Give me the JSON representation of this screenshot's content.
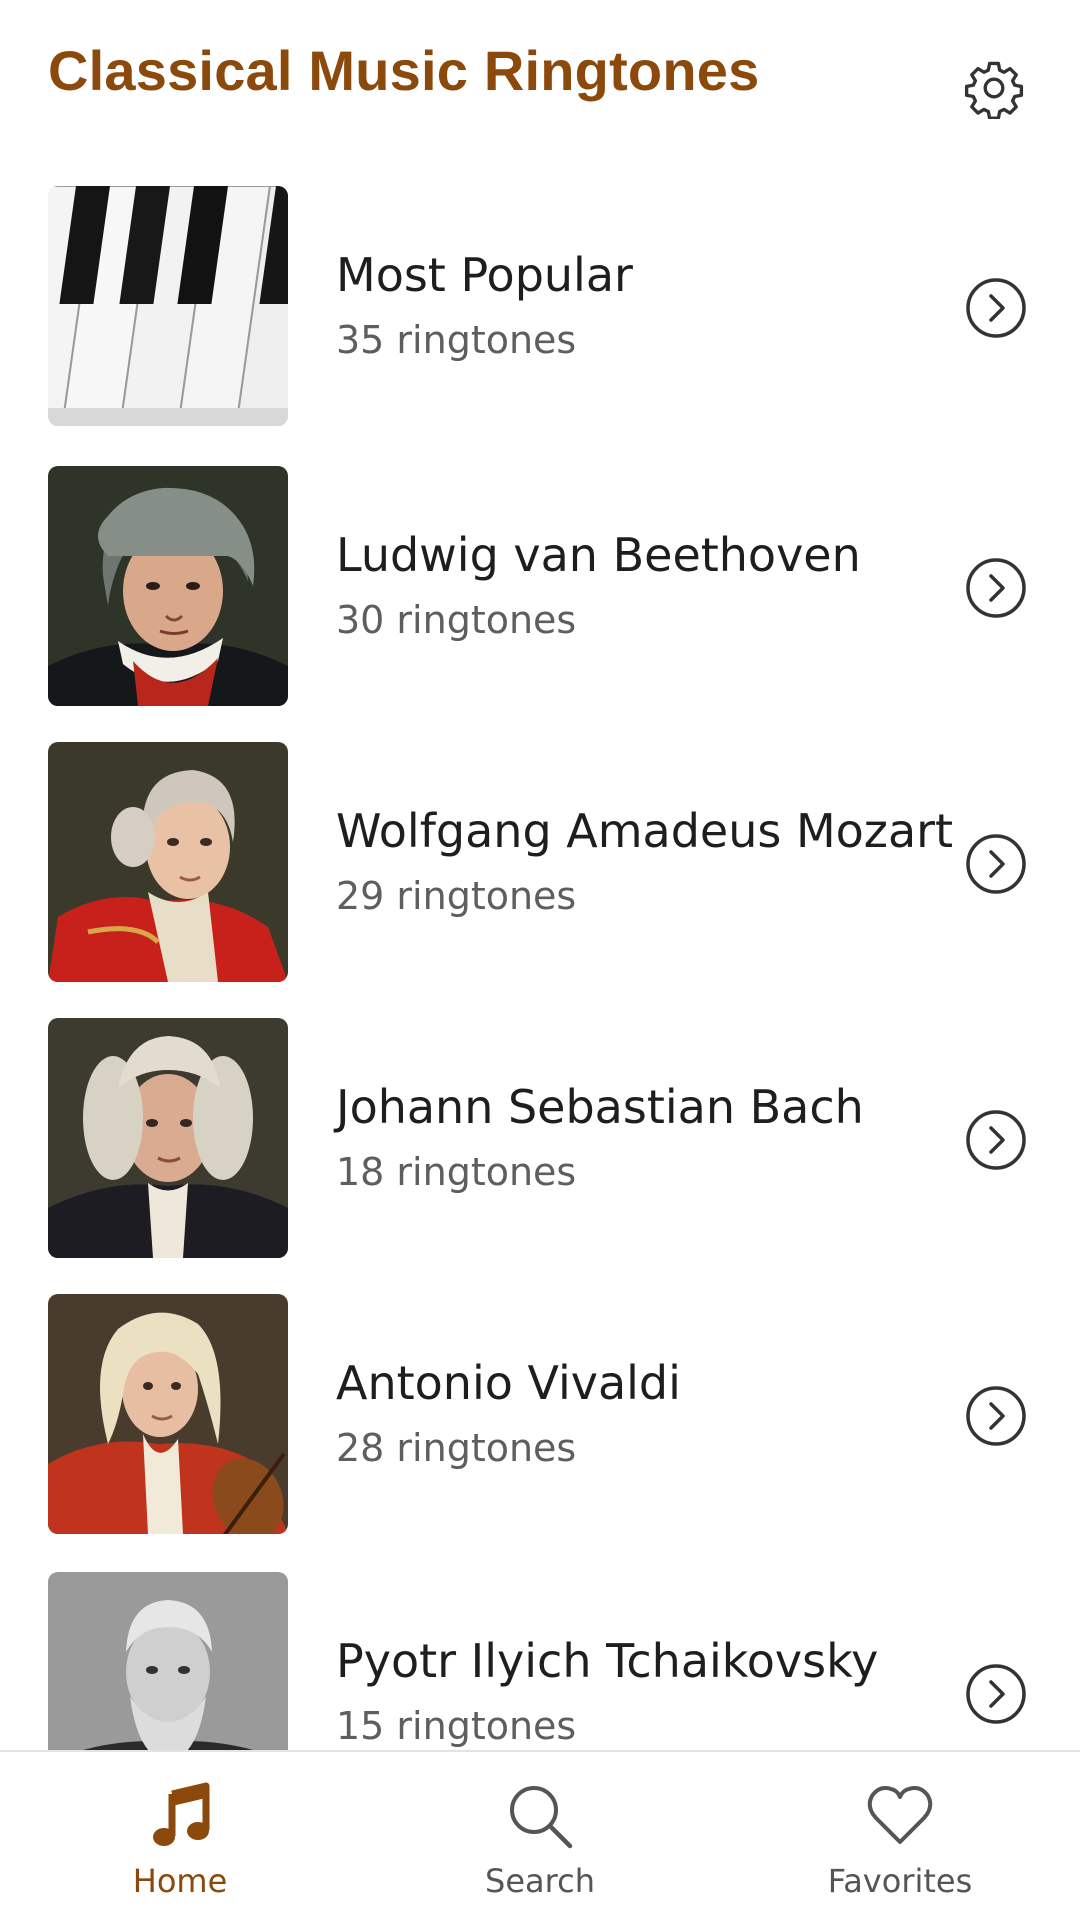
{
  "header": {
    "title": "Classical Music Ringtones",
    "settings_icon": "gear-icon"
  },
  "colors": {
    "accent": "#8B4A0C",
    "text_primary": "#1e1e1e",
    "text_secondary": "#5e5e5e",
    "icon": "#333333"
  },
  "categories": [
    {
      "title": "Most Popular",
      "count": "35 ringtones",
      "image": "piano-keys"
    },
    {
      "title": "Ludwig van Beethoven",
      "count": "30 ringtones",
      "image": "portrait-beethoven"
    },
    {
      "title": "Wolfgang Amadeus Mozart",
      "count": "29 ringtones",
      "image": "portrait-mozart"
    },
    {
      "title": "Johann Sebastian Bach",
      "count": "18 ringtones",
      "image": "portrait-bach"
    },
    {
      "title": "Antonio Vivaldi",
      "count": "28 ringtones",
      "image": "portrait-vivaldi"
    },
    {
      "title": "Pyotr Ilyich Tchaikovsky",
      "count": "15 ringtones",
      "image": "portrait-tchaikovsky"
    }
  ],
  "bottom_nav": [
    {
      "label": "Home",
      "icon": "music-note-icon",
      "active": true
    },
    {
      "label": "Search",
      "icon": "search-icon",
      "active": false
    },
    {
      "label": "Favorites",
      "icon": "heart-icon",
      "active": false
    }
  ]
}
